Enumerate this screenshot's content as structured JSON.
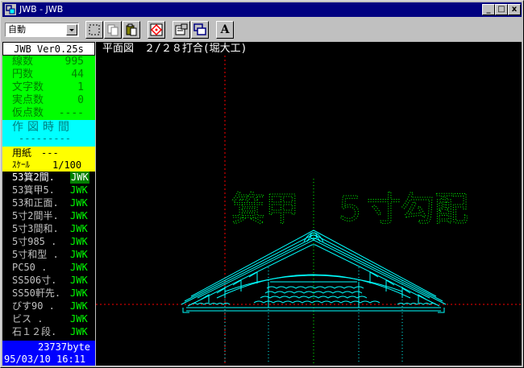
{
  "window": {
    "title": "JWB - JWB"
  },
  "titlebar": {
    "minimize_glyph": "_",
    "maximize_glyph": "□",
    "close_glyph": "x"
  },
  "toolbar": {
    "mode_select": {
      "value": "自動"
    },
    "font_button_label": "A",
    "icons": [
      "select-rect-icon",
      "copy-icon",
      "paste-icon",
      "red-diamond-icon",
      "properties-icon",
      "layer-icon",
      "font-icon"
    ]
  },
  "status": {
    "title": "平面図　２/２８打合(堀大工)"
  },
  "panel": {
    "version": "JWB Ver0.25s",
    "stats": [
      {
        "label": "線数",
        "value": "995"
      },
      {
        "label": "円数",
        "value": "44"
      },
      {
        "label": "文字数",
        "value": "1"
      },
      {
        "label": "実点数",
        "value": "0"
      },
      {
        "label": "仮点数",
        "value": "----"
      }
    ],
    "time": {
      "label": "作図時間",
      "value": "---------"
    },
    "paper": {
      "label": "用紙",
      "value": "---"
    },
    "scale": {
      "label": "ｽｹｰﾙ",
      "value": "1/100"
    },
    "files": [
      {
        "name": "53箕2間.",
        "ext": "JWK",
        "selected": true
      },
      {
        "name": "53箕甲5.",
        "ext": "JWK"
      },
      {
        "name": "53和正面.",
        "ext": "JWK"
      },
      {
        "name": "5寸2間半.",
        "ext": "JWK"
      },
      {
        "name": "5寸3間和.",
        "ext": "JWK"
      },
      {
        "name": "5寸985  .",
        "ext": "JWK"
      },
      {
        "name": "5寸和型 .",
        "ext": "JWK"
      },
      {
        "name": "PC50    .",
        "ext": "JWK"
      },
      {
        "name": "SS506寸.",
        "ext": "JWK"
      },
      {
        "name": "SS50軒先.",
        "ext": "JWK"
      },
      {
        "name": "びす90  .",
        "ext": "JWK"
      },
      {
        "name": "ビス    .",
        "ext": "JWK"
      },
      {
        "name": "石１２段.",
        "ext": "JWK"
      }
    ],
    "footer": {
      "bytes": "23737byte",
      "timestamp": "95/03/10 16:11"
    }
  },
  "drawing": {
    "label": "箕甲　５寸勾配"
  },
  "colors": {
    "titlebar": "#000080",
    "canvas_bg": "#000000",
    "drawing_lines": "#00ffff",
    "guide_lines": "#ff0000",
    "dotted_guides": "#00ff00",
    "stats_bg": "#00ff00",
    "time_bg": "#00ffff",
    "paper_bg": "#ffff00",
    "footer_bg": "#0000ff"
  }
}
